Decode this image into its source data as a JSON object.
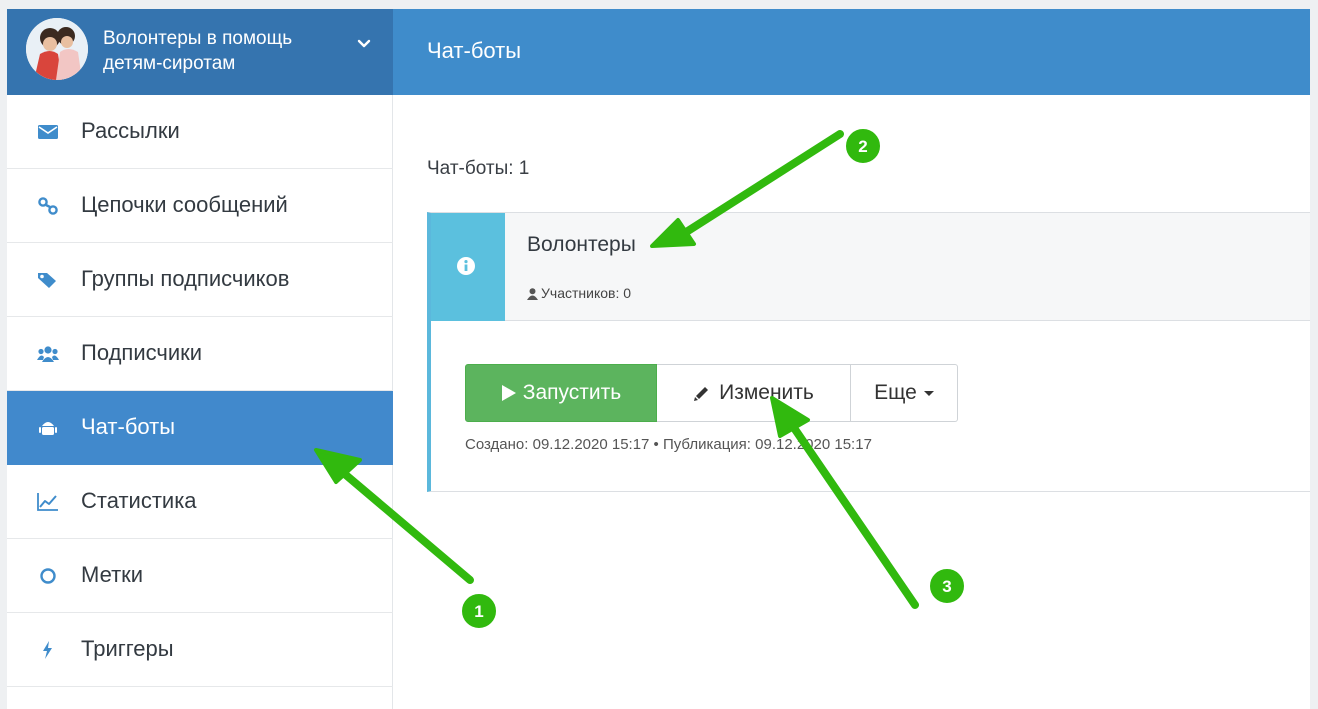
{
  "brand": {
    "name": "Волонтеры в помощь детям-сиротам"
  },
  "header": {
    "title": "Чат-боты"
  },
  "sidebar": {
    "items": [
      {
        "label": "Рассылки",
        "icon": "envelope-icon"
      },
      {
        "label": "Цепочки сообщений",
        "icon": "chain-icon"
      },
      {
        "label": "Группы подписчиков",
        "icon": "tags-icon"
      },
      {
        "label": "Подписчики",
        "icon": "users-icon"
      },
      {
        "label": "Чат-боты",
        "icon": "android-icon",
        "active": true
      },
      {
        "label": "Статистика",
        "icon": "line-chart-icon"
      },
      {
        "label": "Метки",
        "icon": "circle-icon"
      },
      {
        "label": "Триггеры",
        "icon": "bolt-icon"
      }
    ]
  },
  "main": {
    "count_label": "Чат-боты: 1",
    "bot": {
      "name": "Волонтеры",
      "members": "Участников: 0",
      "run_label": "Запустить",
      "edit_label": "Изменить",
      "more_label": "Еще",
      "meta": "Создано: 09.12.2020 15:17 • Публикация: 09.12.2020 15:17"
    }
  },
  "annotations": [
    {
      "number": "1"
    },
    {
      "number": "2"
    },
    {
      "number": "3"
    }
  ],
  "colors": {
    "header": "#3f8ccb",
    "brand_bg": "#3574af",
    "active_item": "#4189cc",
    "info_strip": "#5bc0de",
    "run_button": "#5cb45e",
    "annotation": "#31b90e"
  }
}
